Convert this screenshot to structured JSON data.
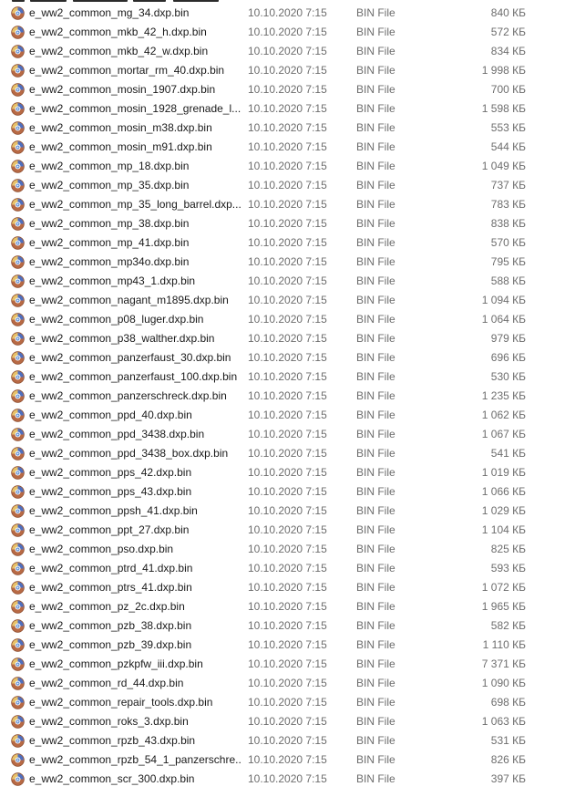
{
  "icon": "dxp-bin-file-icon",
  "rows": [
    {
      "name": "e_ww2_common_mg_34.dxp.bin",
      "date": "10.10.2020 7:15",
      "type": "BIN File",
      "size": "840 КБ"
    },
    {
      "name": "e_ww2_common_mkb_42_h.dxp.bin",
      "date": "10.10.2020 7:15",
      "type": "BIN File",
      "size": "572 КБ"
    },
    {
      "name": "e_ww2_common_mkb_42_w.dxp.bin",
      "date": "10.10.2020 7:15",
      "type": "BIN File",
      "size": "834 КБ"
    },
    {
      "name": "e_ww2_common_mortar_rm_40.dxp.bin",
      "date": "10.10.2020 7:15",
      "type": "BIN File",
      "size": "1 998 КБ"
    },
    {
      "name": "e_ww2_common_mosin_1907.dxp.bin",
      "date": "10.10.2020 7:15",
      "type": "BIN File",
      "size": "700 КБ"
    },
    {
      "name": "e_ww2_common_mosin_1928_grenade_l...",
      "date": "10.10.2020 7:15",
      "type": "BIN File",
      "size": "1 598 КБ"
    },
    {
      "name": "e_ww2_common_mosin_m38.dxp.bin",
      "date": "10.10.2020 7:15",
      "type": "BIN File",
      "size": "553 КБ"
    },
    {
      "name": "e_ww2_common_mosin_m91.dxp.bin",
      "date": "10.10.2020 7:15",
      "type": "BIN File",
      "size": "544 КБ"
    },
    {
      "name": "e_ww2_common_mp_18.dxp.bin",
      "date": "10.10.2020 7:15",
      "type": "BIN File",
      "size": "1 049 КБ"
    },
    {
      "name": "e_ww2_common_mp_35.dxp.bin",
      "date": "10.10.2020 7:15",
      "type": "BIN File",
      "size": "737 КБ"
    },
    {
      "name": "e_ww2_common_mp_35_long_barrel.dxp...",
      "date": "10.10.2020 7:15",
      "type": "BIN File",
      "size": "783 КБ"
    },
    {
      "name": "e_ww2_common_mp_38.dxp.bin",
      "date": "10.10.2020 7:15",
      "type": "BIN File",
      "size": "838 КБ"
    },
    {
      "name": "e_ww2_common_mp_41.dxp.bin",
      "date": "10.10.2020 7:15",
      "type": "BIN File",
      "size": "570 КБ"
    },
    {
      "name": "e_ww2_common_mp34o.dxp.bin",
      "date": "10.10.2020 7:15",
      "type": "BIN File",
      "size": "795 КБ"
    },
    {
      "name": "e_ww2_common_mp43_1.dxp.bin",
      "date": "10.10.2020 7:15",
      "type": "BIN File",
      "size": "588 КБ"
    },
    {
      "name": "e_ww2_common_nagant_m1895.dxp.bin",
      "date": "10.10.2020 7:15",
      "type": "BIN File",
      "size": "1 094 КБ"
    },
    {
      "name": "e_ww2_common_p08_luger.dxp.bin",
      "date": "10.10.2020 7:15",
      "type": "BIN File",
      "size": "1 064 КБ"
    },
    {
      "name": "e_ww2_common_p38_walther.dxp.bin",
      "date": "10.10.2020 7:15",
      "type": "BIN File",
      "size": "979 КБ"
    },
    {
      "name": "e_ww2_common_panzerfaust_30.dxp.bin",
      "date": "10.10.2020 7:15",
      "type": "BIN File",
      "size": "696 КБ"
    },
    {
      "name": "e_ww2_common_panzerfaust_100.dxp.bin",
      "date": "10.10.2020 7:15",
      "type": "BIN File",
      "size": "530 КБ"
    },
    {
      "name": "e_ww2_common_panzerschreck.dxp.bin",
      "date": "10.10.2020 7:15",
      "type": "BIN File",
      "size": "1 235 КБ"
    },
    {
      "name": "e_ww2_common_ppd_40.dxp.bin",
      "date": "10.10.2020 7:15",
      "type": "BIN File",
      "size": "1 062 КБ"
    },
    {
      "name": "e_ww2_common_ppd_3438.dxp.bin",
      "date": "10.10.2020 7:15",
      "type": "BIN File",
      "size": "1 067 КБ"
    },
    {
      "name": "e_ww2_common_ppd_3438_box.dxp.bin",
      "date": "10.10.2020 7:15",
      "type": "BIN File",
      "size": "541 КБ"
    },
    {
      "name": "e_ww2_common_pps_42.dxp.bin",
      "date": "10.10.2020 7:15",
      "type": "BIN File",
      "size": "1 019 КБ"
    },
    {
      "name": "e_ww2_common_pps_43.dxp.bin",
      "date": "10.10.2020 7:15",
      "type": "BIN File",
      "size": "1 066 КБ"
    },
    {
      "name": "e_ww2_common_ppsh_41.dxp.bin",
      "date": "10.10.2020 7:15",
      "type": "BIN File",
      "size": "1 029 КБ"
    },
    {
      "name": "e_ww2_common_ppt_27.dxp.bin",
      "date": "10.10.2020 7:15",
      "type": "BIN File",
      "size": "1 104 КБ"
    },
    {
      "name": "e_ww2_common_pso.dxp.bin",
      "date": "10.10.2020 7:15",
      "type": "BIN File",
      "size": "825 КБ"
    },
    {
      "name": "e_ww2_common_ptrd_41.dxp.bin",
      "date": "10.10.2020 7:15",
      "type": "BIN File",
      "size": "593 КБ"
    },
    {
      "name": "e_ww2_common_ptrs_41.dxp.bin",
      "date": "10.10.2020 7:15",
      "type": "BIN File",
      "size": "1 072 КБ"
    },
    {
      "name": "e_ww2_common_pz_2c.dxp.bin",
      "date": "10.10.2020 7:15",
      "type": "BIN File",
      "size": "1 965 КБ"
    },
    {
      "name": "e_ww2_common_pzb_38.dxp.bin",
      "date": "10.10.2020 7:15",
      "type": "BIN File",
      "size": "582 КБ"
    },
    {
      "name": "e_ww2_common_pzb_39.dxp.bin",
      "date": "10.10.2020 7:15",
      "type": "BIN File",
      "size": "1 110 КБ"
    },
    {
      "name": "e_ww2_common_pzkpfw_iii.dxp.bin",
      "date": "10.10.2020 7:15",
      "type": "BIN File",
      "size": "7 371 КБ"
    },
    {
      "name": "e_ww2_common_rd_44.dxp.bin",
      "date": "10.10.2020 7:15",
      "type": "BIN File",
      "size": "1 090 КБ"
    },
    {
      "name": "e_ww2_common_repair_tools.dxp.bin",
      "date": "10.10.2020 7:15",
      "type": "BIN File",
      "size": "698 КБ"
    },
    {
      "name": "e_ww2_common_roks_3.dxp.bin",
      "date": "10.10.2020 7:15",
      "type": "BIN File",
      "size": "1 063 КБ"
    },
    {
      "name": "e_ww2_common_rpzb_43.dxp.bin",
      "date": "10.10.2020 7:15",
      "type": "BIN File",
      "size": "531 КБ"
    },
    {
      "name": "e_ww2_common_rpzb_54_1_panzerschre...",
      "date": "10.10.2020 7:15",
      "type": "BIN File",
      "size": "826 КБ"
    },
    {
      "name": "e_ww2_common_scr_300.dxp.bin",
      "date": "10.10.2020 7:15",
      "type": "BIN File",
      "size": "397 КБ"
    }
  ]
}
